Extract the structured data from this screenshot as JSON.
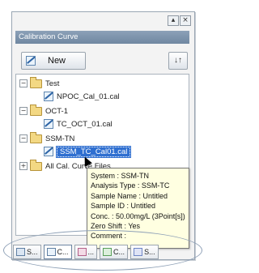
{
  "window": {
    "title": "Calibration Curve",
    "controls": [
      "▴",
      "×"
    ]
  },
  "toolbar": {
    "new_label": "New",
    "sort_label": "↓↑"
  },
  "tree": {
    "items": [
      {
        "label": "Test",
        "expander": "−"
      },
      {
        "label": "NPOC_Cal_01.cal"
      },
      {
        "label": "OCT-1",
        "expander": "−"
      },
      {
        "label": "TC_OCT_01.cal"
      },
      {
        "label": "SSM-TN",
        "expander": "−"
      },
      {
        "label": "SSM_TC_Cal01.cal"
      },
      {
        "label": "All Cal. Curve Files",
        "expander": "+"
      }
    ]
  },
  "tooltip": {
    "lines": [
      "System : SSM-TN",
      "Analysis Type : SSM-TC",
      "Sample Name : Untitled",
      "Sample ID : Untitled",
      "Conc. : 50.00mg/L (3Point[s])",
      "Zero Shift : Yes",
      "Comment :"
    ]
  },
  "tabs": [
    {
      "label": "S...",
      "icon_color": "#6f8fb5"
    },
    {
      "label": "C...",
      "icon_color": "#3e79c2"
    },
    {
      "label": "...",
      "icon_color": "#c05a8a"
    },
    {
      "label": "C...",
      "icon_color": "#5aa05a"
    },
    {
      "label": "S...",
      "icon_color": "#6f86c6"
    }
  ]
}
